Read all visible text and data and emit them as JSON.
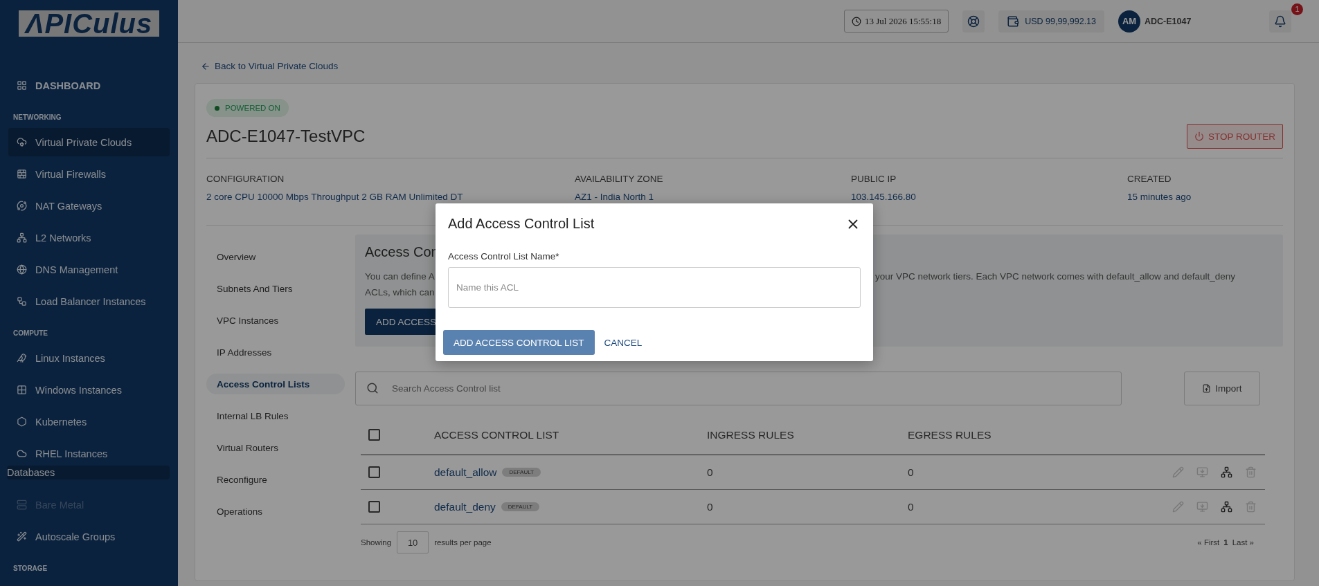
{
  "sidebar": {
    "logo": "ΛPICulus",
    "items": [
      {
        "kind": "top",
        "label": "DASHBOARD",
        "selected": false,
        "disabled": false
      },
      {
        "kind": "section",
        "label": "NETWORKING"
      },
      {
        "kind": "link",
        "label": "Virtual Private Clouds",
        "selected": true,
        "disabled": false
      },
      {
        "kind": "link",
        "label": "Virtual Firewalls",
        "selected": false,
        "disabled": false
      },
      {
        "kind": "link",
        "label": "NAT Gateways",
        "selected": false,
        "disabled": false
      },
      {
        "kind": "link",
        "label": "L2 Networks",
        "selected": false,
        "disabled": false
      },
      {
        "kind": "link",
        "label": "DNS Management",
        "selected": false,
        "disabled": false
      },
      {
        "kind": "link",
        "label": "Load Balancer Instances",
        "selected": false,
        "disabled": false
      },
      {
        "kind": "section",
        "label": "COMPUTE"
      },
      {
        "kind": "link",
        "label": "Linux Instances",
        "selected": false,
        "disabled": false
      },
      {
        "kind": "link",
        "label": "Windows Instances",
        "selected": false,
        "disabled": false
      },
      {
        "kind": "link",
        "label": "Kubernetes",
        "selected": false,
        "disabled": false
      },
      {
        "kind": "link",
        "label": "RHEL Instances",
        "selected": false,
        "disabled": false
      },
      {
        "kind": "group",
        "label": "Databases",
        "selected": true,
        "disabled": false
      },
      {
        "kind": "link",
        "label": "Bare Metal",
        "selected": false,
        "disabled": true
      },
      {
        "kind": "link",
        "label": "Autoscale Groups",
        "selected": false,
        "disabled": false
      },
      {
        "kind": "section",
        "label": "STORAGE"
      }
    ]
  },
  "header": {
    "datetime": "13 Jul 2026 15:55:18",
    "balance": "USD 99,99,992.13",
    "avatar": "AM",
    "account": "ADC-E1047",
    "notifications": "1"
  },
  "back_link": "Back to Virtual Private Clouds",
  "vpc": {
    "status": "POWERED ON",
    "name": "ADC-E1047-TestVPC",
    "stop_button": "STOP ROUTER",
    "details": [
      {
        "label": "CONFIGURATION",
        "value": "2 core CPU 10000 Mbps Throughput 2 GB RAM Unlimited DT"
      },
      {
        "label": "AVAILABILITY ZONE",
        "value": "AZ1 - India North 1"
      },
      {
        "label": "PUBLIC IP",
        "value": "103.145.166.80"
      },
      {
        "label": "CREATED",
        "value": "15 minutes ago"
      }
    ]
  },
  "tabs": [
    {
      "label": "Overview",
      "selected": false
    },
    {
      "label": "Subnets And Tiers",
      "selected": false
    },
    {
      "label": "VPC Instances",
      "selected": false
    },
    {
      "label": "IP Addresses",
      "selected": false
    },
    {
      "label": "Access Control Lists",
      "selected": true
    },
    {
      "label": "Internal LB Rules",
      "selected": false
    },
    {
      "label": "Virtual Routers",
      "selected": false
    },
    {
      "label": "Reconfigure",
      "selected": false
    },
    {
      "label": "Operations",
      "selected": false
    }
  ],
  "info": {
    "title": "Access Con",
    "line_1_left": "You can define A",
    "line_1_right": "your VPC network tiers. Each VPC network comes with default_allow and default_deny",
    "line_2": "ACLs, which can",
    "button": "ADD ACCESS"
  },
  "search": {
    "placeholder": "Search Access Control list"
  },
  "import_button": "Import",
  "table": {
    "header_checked": false,
    "columns": [
      "ACCESS CONTROL LIST",
      "INGRESS RULES",
      "EGRESS RULES"
    ],
    "rows": [
      {
        "checked": false,
        "name": "default_allow",
        "tag": "DEFAULT",
        "ingress": "0",
        "egress": "0"
      },
      {
        "checked": false,
        "name": "default_deny",
        "tag": "DEFAULT",
        "ingress": "0",
        "egress": "0"
      }
    ]
  },
  "footer": {
    "showing": "Showing",
    "per_page": "10",
    "results": "results per page",
    "first": "« First",
    "page": "1",
    "last": "Last »"
  },
  "modal": {
    "title": "Add Access Control List",
    "field_label": "Access Control List Name*",
    "placeholder": "Name this ACL",
    "submit": "ADD ACCESS CONTROL LIST",
    "cancel": "CANCEL"
  }
}
